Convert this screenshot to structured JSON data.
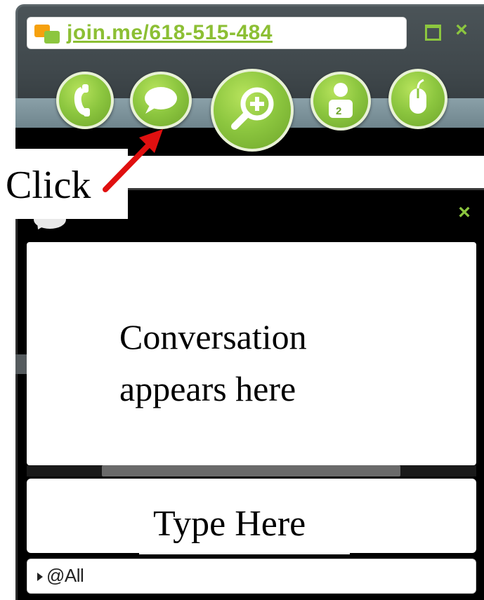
{
  "window": {
    "url": "join.me/618-515-484"
  },
  "toolbar": {
    "buttons": [
      {
        "name": "phone-button",
        "icon": "phone-icon"
      },
      {
        "name": "chat-button",
        "icon": "speech-bubble-icon"
      },
      {
        "name": "zoom-button",
        "icon": "magnifier-plus-icon"
      },
      {
        "name": "participants-button",
        "icon": "person-icon",
        "badge": "2"
      },
      {
        "name": "mouse-control-button",
        "icon": "mouse-icon"
      }
    ],
    "accent_color": "#8cc63f",
    "logo_colors": [
      "#f6a10e",
      "#8cc63f"
    ]
  },
  "annotation": {
    "label": "Click",
    "arrow_color": "#e01010"
  },
  "chat": {
    "conversation_text": "Conversation\nappears here",
    "input_text": "Type Here",
    "recipient": "@All"
  }
}
